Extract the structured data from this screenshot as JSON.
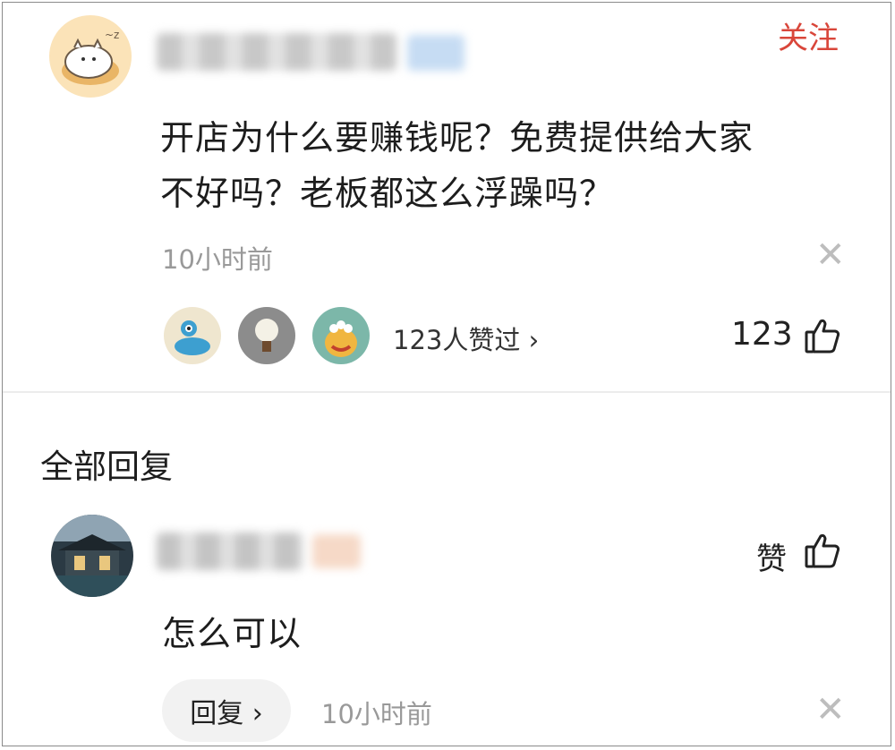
{
  "post": {
    "follow_label": "关注",
    "text_line1": "开店为什么要赚钱呢？免费提供给大家",
    "text_line2": "不好吗？老板都这么浮躁吗？",
    "time": "10小时前",
    "likers_text": "123人赞过 ›",
    "like_count": "123"
  },
  "replies_section": {
    "title": "全部回复"
  },
  "reply": {
    "like_label": "赞",
    "text": "怎么可以",
    "reply_button": "回复 ›",
    "time": "10小时前"
  },
  "icons": {
    "close": "close-icon",
    "thumbs_up": "thumbs-up-icon",
    "chevron": "chevron-right-icon"
  },
  "colors": {
    "accent": "#d9463a",
    "muted": "#999999",
    "divider": "#ececec",
    "pill_bg": "#f2f2f2"
  }
}
